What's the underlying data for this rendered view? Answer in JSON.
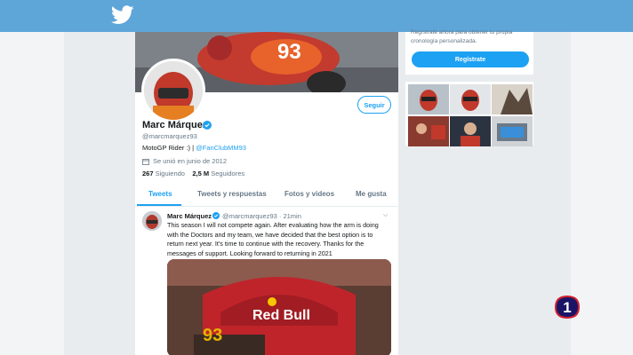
{
  "profile": {
    "name": "Marc Márquez",
    "handle": "@marcmarquez93",
    "bio_prefix": "MotoGP Rider :) | ",
    "bio_link": "@FanClubMM93",
    "joined": "Se unió en junio de 2012",
    "following_count": "267",
    "following_label": "Siguiendo",
    "followers_count": "2,5 M",
    "followers_label": "Seguidores",
    "follow_button": "Seguir"
  },
  "tabs": [
    {
      "label": "Tweets"
    },
    {
      "label": "Tweets y respuestas"
    },
    {
      "label": "Fotos y videos"
    },
    {
      "label": "Me gusta"
    }
  ],
  "tweet": {
    "name": "Marc Márquez",
    "handle_time": "@marcmarquez93 · 21min",
    "text": "This season I will not compete again. After evaluating how the arm is doing with the Doctors and my team, we have decided that the best option is to return next year. It's time to continue with the recovery. Thanks for the messages of support. Looking forward to returning in 2021"
  },
  "right": {
    "signup_text": "Regístrate ahora para obtener tu propia cronología personalizada.",
    "signup_button": "Regístrate"
  },
  "channel_logo": "1",
  "colors": {
    "topbar": "#5fa6d8",
    "accent": "#1da1f2",
    "logo_red": "#d0202e"
  }
}
